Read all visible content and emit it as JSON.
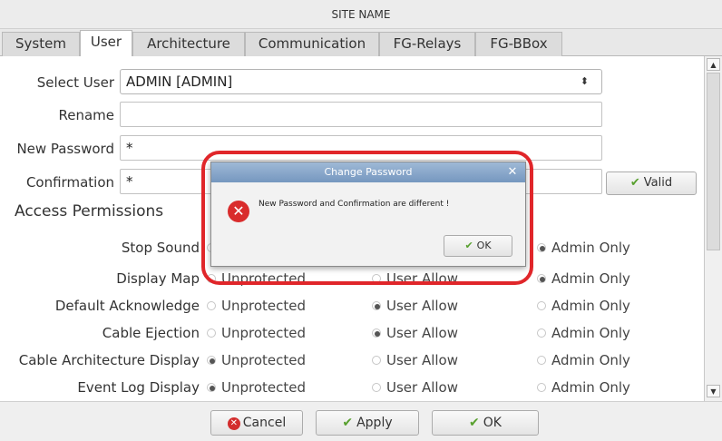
{
  "window": {
    "title": "SITE NAME"
  },
  "tabs": [
    {
      "label": "System"
    },
    {
      "label": "User"
    },
    {
      "label": "Architecture"
    },
    {
      "label": "Communication"
    },
    {
      "label": "FG-Relays"
    },
    {
      "label": "FG-BBox"
    }
  ],
  "form": {
    "select_user_label": "Select User",
    "select_user_value": "ADMIN [ADMIN]",
    "rename_label": "Rename",
    "rename_value": "",
    "new_password_label": "New Password",
    "new_password_value": "*",
    "confirmation_label": "Confirmation",
    "confirmation_value": "*",
    "valid_label": "Valid"
  },
  "permissions": {
    "title": "Access Permissions",
    "options": [
      "Unprotected",
      "User Allow",
      "Admin Only"
    ],
    "rows": [
      {
        "label": "Stop Sound",
        "selected": 2
      },
      {
        "label": "Display Map",
        "selected": 2
      },
      {
        "label": "Default Acknowledge",
        "selected": 1
      },
      {
        "label": "Cable Ejection",
        "selected": 1
      },
      {
        "label": "Cable Architecture Display",
        "selected": 0
      },
      {
        "label": "Event Log Display",
        "selected": 0
      }
    ]
  },
  "footer": {
    "cancel_label": "Cancel",
    "apply_label": "Apply",
    "ok_label": "OK"
  },
  "dialog": {
    "title": "Change Password",
    "message": "New Password and Confirmation are different !",
    "ok_label": "OK",
    "close_icon": "close-icon",
    "error_icon": "error-icon"
  },
  "colors": {
    "highlight": "#e0262a",
    "dialog_title": "#7597bf",
    "check": "#58a02f",
    "error": "#d92c2c"
  }
}
